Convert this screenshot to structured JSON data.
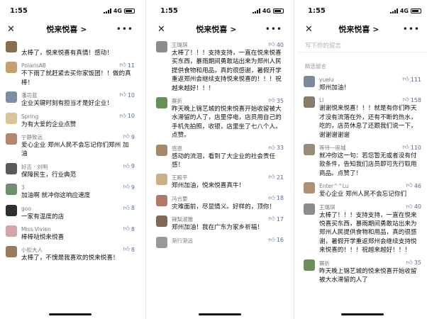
{
  "screens": [
    {
      "status_time": "1:55",
      "network": "4G",
      "title": "悦来悦喜 >",
      "comments": [
        {
          "name": "",
          "text": "太棒了，悦来悦喜有真情！感动！",
          "likes": "",
          "avatar_color": "#8a6d4a"
        },
        {
          "name": "PolarisAB",
          "text": "不下雨了就赶紧去买你家饭团！！做的真棒！",
          "likes": "11",
          "avatar_color": "#c8a070"
        },
        {
          "name": "潘司蓝",
          "text": "企业关键时刻有担当才是好企业！",
          "likes": "10",
          "avatar_color": "#7d8fa6"
        },
        {
          "name": "Spring",
          "text": "为有大爱的企业点赞",
          "likes": "10",
          "avatar_color": "#d9c49a"
        },
        {
          "name": "宁静致远",
          "text": "爱心企业 郑州人民不会忘记你们郑州 加油",
          "likes": "9",
          "avatar_color": "#b5876a"
        },
        {
          "name": "好吉 · 刘明",
          "text": "保障民生，行业典范",
          "likes": "9",
          "avatar_color": "#5a5a5a"
        },
        {
          "name": "3",
          "text": "加油啊 就冲你这响应速度",
          "likes": "9",
          "avatar_color": "#6f8f6f"
        },
        {
          "name": "goo",
          "text": "一家有温度的店",
          "likes": "8",
          "avatar_color": "#2f2f2f"
        },
        {
          "name": "Miss Vivien",
          "text": "棒棒哒悦来悦喜",
          "likes": "8",
          "avatar_color": "#d4a5a5"
        },
        {
          "name": "小松大人",
          "text": "太棒了，不愧是我喜欢的悦来悦喜！",
          "likes": "8",
          "avatar_color": "#9a7b5b"
        }
      ]
    },
    {
      "status_time": "1:55",
      "network": "4G",
      "title": "悦来悦喜 >",
      "comments": [
        {
          "name": "王璐琪",
          "text": "太棒了！！！支持支持，一直在悦来悦喜买东西，暴雨期间勇敢站出来为郑州人民提供食物和用品，真的很感谢，暑假开学重返郑州会继续支持悦来悦喜的！！！祝越来越好！！！",
          "likes": "40",
          "avatar_color": "#8c8c8c"
        },
        {
          "name": "赛折",
          "text": "昨天晚上锦艺城的悦来悦喜开始收留被大水滞留的人了，店里停电，店员用自己的手机先拍照，收银，店里坐了七八个人。点赞。",
          "likes": "35",
          "avatar_color": "#6b8e5a"
        },
        {
          "name": "感恩",
          "text": "感动的流泪，看到了大企业的社会责任感！",
          "likes": "33",
          "avatar_color": "#a58a6a"
        },
        {
          "name": "王殿平",
          "text": "郑州加油，悦来悦喜真牛！",
          "likes": "21",
          "avatar_color": "#c9b089"
        },
        {
          "name": "冯合要",
          "text": "灾难面前，尽显情义。好样的，顶你！",
          "likes": "18",
          "avatar_color": "#b07a6a"
        },
        {
          "name": "辣梨淑雅",
          "text": "郑州加油！我在广东为家乡祈福！",
          "likes": "17",
          "avatar_color": "#7f6a5a"
        },
        {
          "name": "渐行渐远",
          "text": "",
          "likes": "16",
          "avatar_color": "#999999"
        }
      ]
    },
    {
      "status_time": "1:55",
      "network": "4G",
      "title": "悦来悦喜 >",
      "search_placeholder": "写下你的留言",
      "section_label": "精选留言",
      "comments": [
        {
          "name": "yuelu",
          "text": "郑州加油！",
          "likes": "111",
          "avatar_color": "#7a8a9a"
        },
        {
          "name": "LI",
          "text": "谢谢悦来悦喜！！！就是有你们昨天才没有流落在外，还有不断的热水，吃的，店员休息了还跟我们说一下，谢谢谢谢谢",
          "likes": "158",
          "avatar_color": "#8a7a6a"
        },
        {
          "name": "等待一座城",
          "text": "就冲你这一句：若您暂无或者没有付款条件，告知我们店员即可先行取用商品。点赞了！",
          "likes": "110",
          "avatar_color": "#9a8a7a"
        },
        {
          "name": "Enter^^Lu",
          "text": "爱心企业 郑州人民不会忘记你们",
          "likes": "46",
          "avatar_color": "#b09070"
        },
        {
          "name": "王璐琪",
          "text": "太棒了！！！支持支持，一直在悦来悦喜买东西，暴雨期间勇敢站出来为郑州人民提供食物和用品，真的很感谢，暑假开学重返郑州会继续支持悦来悦喜的！！！祝越来越好！！！",
          "likes": "40",
          "avatar_color": "#8c8c8c"
        },
        {
          "name": "赛折",
          "text": "昨天晚上锦艺城的悦来悦喜开始收留被大水滞留的人了",
          "likes": "35",
          "avatar_color": "#6b8e5a"
        }
      ]
    }
  ]
}
